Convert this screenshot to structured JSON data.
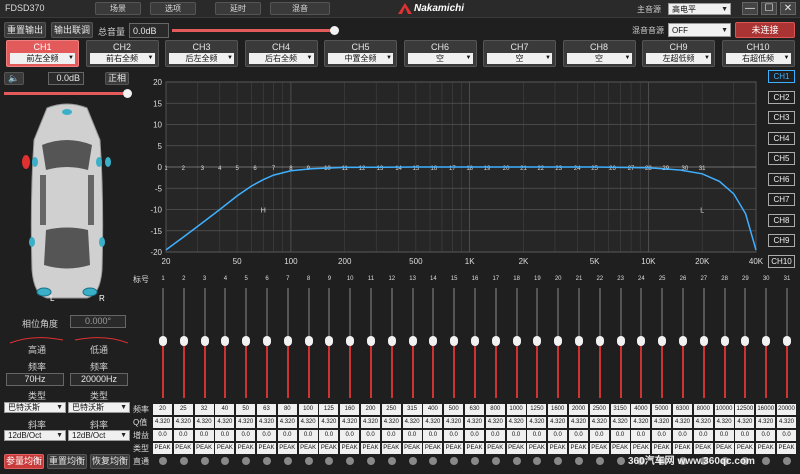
{
  "app": {
    "title": "FDSD370",
    "brand": "Nakamichi"
  },
  "menu_tabs": [
    "场景",
    "选项",
    "延时",
    "混音"
  ],
  "main_source": {
    "label": "主音源",
    "value": "高电平"
  },
  "window_controls": {
    "minimize": "—",
    "maximize": "☐",
    "close": "✕"
  },
  "toolbar": {
    "reset_output": "重置输出",
    "output_link": "输出联调",
    "master_volume_label": "总音量",
    "master_volume_value": "0.0dB",
    "master_volume_level": 0.98,
    "mix_source_label": "混音音源",
    "mix_source_value": "OFF",
    "connect_status": "未连接"
  },
  "channels": [
    {
      "name": "CH1",
      "position": "前左全频",
      "active": true
    },
    {
      "name": "CH2",
      "position": "前右全频",
      "active": false
    },
    {
      "name": "CH3",
      "position": "后左全频",
      "active": false
    },
    {
      "name": "CH4",
      "position": "后右全频",
      "active": false
    },
    {
      "name": "CH5",
      "position": "中置全频",
      "active": false
    },
    {
      "name": "CH6",
      "position": "空",
      "active": false
    },
    {
      "name": "CH7",
      "position": "空",
      "active": false
    },
    {
      "name": "CH8",
      "position": "空",
      "active": false
    },
    {
      "name": "CH9",
      "position": "左超低频",
      "active": false
    },
    {
      "name": "CH10",
      "position": "右超低频",
      "active": false
    }
  ],
  "channel_volume": {
    "value": "0.0dB",
    "phase": "正相",
    "level": 0.98
  },
  "car": {
    "left_label": "L",
    "right_label": "R"
  },
  "phase_angle": {
    "label": "相位角度",
    "value": "0.000°"
  },
  "crossover": {
    "high_pass_label": "高通",
    "low_pass_label": "低通",
    "freq_label": "频率",
    "hp_freq": "70Hz",
    "lp_freq": "20000Hz",
    "type_label": "类型",
    "hp_type": "巴特沃斯",
    "lp_type": "巴特沃斯",
    "slope_label": "斜率",
    "hp_slope": "12dB/Oct",
    "lp_slope": "12dB/Oct"
  },
  "bottom_buttons": {
    "eq_params": "参量均衡",
    "reset_eq": "重置均衡",
    "restore_eq": "恢复均衡"
  },
  "chart_data": {
    "type": "line",
    "x_ticks": [
      "20",
      "50",
      "100",
      "200",
      "500",
      "1K",
      "2K",
      "5K",
      "10K",
      "20K",
      "40K"
    ],
    "y_ticks": [
      "20",
      "15",
      "10",
      "5",
      "0",
      "-5",
      "-10",
      "-15",
      "-20"
    ],
    "xlim": [
      20,
      40000
    ],
    "ylim": [
      -20,
      20
    ],
    "x_scale": "log",
    "grid": true,
    "band_markers": [
      "1",
      "2",
      "3",
      "4",
      "5",
      "6",
      "7",
      "8",
      "9",
      "10",
      "11",
      "12",
      "13",
      "14",
      "15",
      "16",
      "17",
      "18",
      "19",
      "20",
      "21",
      "22",
      "23",
      "24",
      "25",
      "26",
      "27",
      "28",
      "29",
      "30",
      "31"
    ],
    "hp_marker": "H",
    "lp_marker": "L",
    "series": [
      {
        "x": [
          20,
          25,
          30,
          40,
          50,
          60,
          70,
          80,
          100,
          130,
          200,
          500,
          1000,
          5000,
          10000,
          15000,
          20000,
          25000,
          30000,
          35000,
          40000
        ],
        "y": [
          -19.5,
          -16.5,
          -14,
          -10,
          -6.8,
          -4.5,
          -3.0,
          -1.9,
          -0.9,
          -0.4,
          -0.1,
          0,
          0,
          0,
          -0.2,
          -0.7,
          -1.6,
          -3.4,
          -6.3,
          -11,
          -19.5
        ]
      }
    ]
  },
  "channel_tabs": [
    "CH1",
    "CH2",
    "CH3",
    "CH4",
    "CH5",
    "CH6",
    "CH7",
    "CH8",
    "CH9",
    "CH10"
  ],
  "eq": {
    "band_label": "标号",
    "freq_row_label": "频率",
    "q_row_label": "Q值",
    "gain_row_label": "增益",
    "type_row_label": "类型",
    "bypass_row_label": "直通",
    "bands": [
      {
        "index": "1",
        "freq": "20",
        "q": "4.320",
        "gain": "0.0",
        "type": "PEAK"
      },
      {
        "index": "2",
        "freq": "25",
        "q": "4.320",
        "gain": "0.0",
        "type": "PEAK"
      },
      {
        "index": "3",
        "freq": "32",
        "q": "4.320",
        "gain": "0.0",
        "type": "PEAK"
      },
      {
        "index": "4",
        "freq": "40",
        "q": "4.320",
        "gain": "0.0",
        "type": "PEAK"
      },
      {
        "index": "5",
        "freq": "50",
        "q": "4.320",
        "gain": "0.0",
        "type": "PEAK"
      },
      {
        "index": "6",
        "freq": "63",
        "q": "4.320",
        "gain": "0.0",
        "type": "PEAK"
      },
      {
        "index": "7",
        "freq": "80",
        "q": "4.320",
        "gain": "0.0",
        "type": "PEAK"
      },
      {
        "index": "8",
        "freq": "100",
        "q": "4.320",
        "gain": "0.0",
        "type": "PEAK"
      },
      {
        "index": "9",
        "freq": "125",
        "q": "4.320",
        "gain": "0.0",
        "type": "PEAK"
      },
      {
        "index": "10",
        "freq": "160",
        "q": "4.320",
        "gain": "0.0",
        "type": "PEAK"
      },
      {
        "index": "11",
        "freq": "200",
        "q": "4.320",
        "gain": "0.0",
        "type": "PEAK"
      },
      {
        "index": "12",
        "freq": "250",
        "q": "4.320",
        "gain": "0.0",
        "type": "PEAK"
      },
      {
        "index": "13",
        "freq": "315",
        "q": "4.320",
        "gain": "0.0",
        "type": "PEAK"
      },
      {
        "index": "14",
        "freq": "400",
        "q": "4.320",
        "gain": "0.0",
        "type": "PEAK"
      },
      {
        "index": "15",
        "freq": "500",
        "q": "4.320",
        "gain": "0.0",
        "type": "PEAK"
      },
      {
        "index": "16",
        "freq": "630",
        "q": "4.320",
        "gain": "0.0",
        "type": "PEAK"
      },
      {
        "index": "17",
        "freq": "800",
        "q": "4.320",
        "gain": "0.0",
        "type": "PEAK"
      },
      {
        "index": "18",
        "freq": "1000",
        "q": "4.320",
        "gain": "0.0",
        "type": "PEAK"
      },
      {
        "index": "19",
        "freq": "1250",
        "q": "4.320",
        "gain": "0.0",
        "type": "PEAK"
      },
      {
        "index": "20",
        "freq": "1600",
        "q": "4.320",
        "gain": "0.0",
        "type": "PEAK"
      },
      {
        "index": "21",
        "freq": "2000",
        "q": "4.320",
        "gain": "0.0",
        "type": "PEAK"
      },
      {
        "index": "22",
        "freq": "2500",
        "q": "4.320",
        "gain": "0.0",
        "type": "PEAK"
      },
      {
        "index": "23",
        "freq": "3150",
        "q": "4.320",
        "gain": "0.0",
        "type": "PEAK"
      },
      {
        "index": "24",
        "freq": "4000",
        "q": "4.320",
        "gain": "0.0",
        "type": "PEAK"
      },
      {
        "index": "25",
        "freq": "5000",
        "q": "4.320",
        "gain": "0.0",
        "type": "PEAK"
      },
      {
        "index": "26",
        "freq": "6300",
        "q": "4.320",
        "gain": "0.0",
        "type": "PEAK"
      },
      {
        "index": "27",
        "freq": "8000",
        "q": "4.320",
        "gain": "0.0",
        "type": "PEAK"
      },
      {
        "index": "28",
        "freq": "10000",
        "q": "4.320",
        "gain": "0.0",
        "type": "PEAK"
      },
      {
        "index": "29",
        "freq": "12500",
        "q": "4.320",
        "gain": "0.0",
        "type": "PEAK"
      },
      {
        "index": "30",
        "freq": "16000",
        "q": "4.320",
        "gain": "0.0",
        "type": "PEAK"
      },
      {
        "index": "31",
        "freq": "20000",
        "q": "4.320",
        "gain": "0.0",
        "type": "PEAK"
      }
    ]
  },
  "watermark": "360汽车网 www.360qc.com",
  "colors": {
    "accent_red": "#e25a5a",
    "curve_blue": "#3fb0ff",
    "slider_red": "#cc3333"
  }
}
